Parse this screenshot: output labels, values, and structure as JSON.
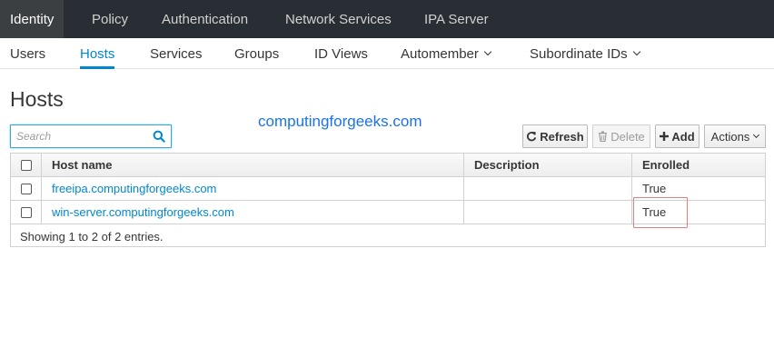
{
  "topnav": {
    "items": [
      "Identity",
      "Policy",
      "Authentication",
      "Network Services",
      "IPA Server"
    ],
    "active": "Identity"
  },
  "subnav": {
    "items": [
      {
        "label": "Users"
      },
      {
        "label": "Hosts",
        "active": true
      },
      {
        "label": "Services"
      },
      {
        "label": "Groups"
      },
      {
        "label": "ID Views"
      },
      {
        "label": "Automember",
        "dropdown": true
      },
      {
        "label": "Subordinate IDs",
        "dropdown": true
      }
    ]
  },
  "page": {
    "title": "Hosts",
    "watermark": "computingforgeeks.com"
  },
  "search": {
    "placeholder": "Search",
    "value": ""
  },
  "toolbar": {
    "refresh": "Refresh",
    "delete": "Delete",
    "add": "Add",
    "actions": "Actions"
  },
  "table": {
    "columns": [
      "Host name",
      "Description",
      "Enrolled"
    ],
    "rows": [
      {
        "host": "freeipa.computingforgeeks.com",
        "description": "",
        "enrolled": "True"
      },
      {
        "host": "win-server.computingforgeeks.com",
        "description": "",
        "enrolled": "True"
      }
    ],
    "footer": "Showing 1 to 2 of 2 entries."
  },
  "colors": {
    "topnav_bg": "#292e34",
    "accent": "#0088ce",
    "highlight_box": "#e47f7f"
  }
}
